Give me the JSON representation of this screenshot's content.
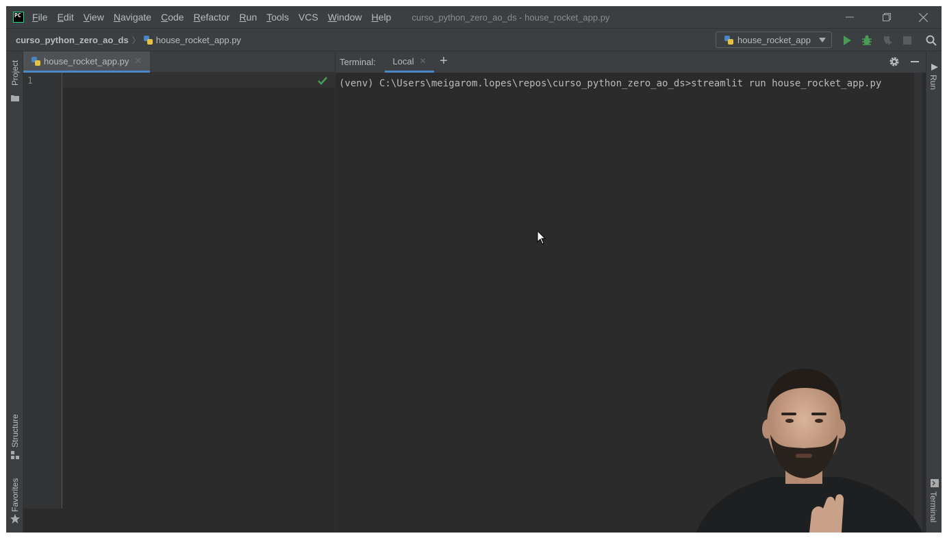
{
  "app": {
    "logo_text": "PC"
  },
  "menu": [
    {
      "label": "File",
      "mnemonic": "F",
      "rest": "ile"
    },
    {
      "label": "Edit",
      "mnemonic": "E",
      "rest": "dit"
    },
    {
      "label": "View",
      "mnemonic": "V",
      "rest": "iew"
    },
    {
      "label": "Navigate",
      "mnemonic": "N",
      "rest": "avigate"
    },
    {
      "label": "Code",
      "mnemonic": "C",
      "rest": "ode"
    },
    {
      "label": "Refactor",
      "mnemonic": "R",
      "rest": "efactor"
    },
    {
      "label": "Run",
      "mnemonic": "R",
      "rest": "un"
    },
    {
      "label": "Tools",
      "mnemonic": "T",
      "rest": "ools"
    },
    {
      "label": "VCS",
      "mnemonic": "",
      "rest": "VCS"
    },
    {
      "label": "Window",
      "mnemonic": "W",
      "rest": "indow"
    },
    {
      "label": "Help",
      "mnemonic": "H",
      "rest": "elp"
    }
  ],
  "window": {
    "title": "curso_python_zero_ao_ds - house_rocket_app.py"
  },
  "navbar": {
    "project": "curso_python_zero_ao_ds",
    "file": "house_rocket_app.py",
    "run_config": "house_rocket_app"
  },
  "tool_windows": {
    "project": "Project",
    "structure": "Structure",
    "favorites": "Favorites",
    "run": "Run",
    "terminal": "Terminal"
  },
  "editor": {
    "tab_label": "house_rocket_app.py",
    "line_numbers": [
      "1"
    ]
  },
  "terminal": {
    "title": "Terminal:",
    "tab_label": "Local",
    "command_line": "(venv) C:\\Users\\meigarom.lopes\\repos\\curso_python_zero_ao_ds>streamlit run house_rocket_app.py"
  },
  "colors": {
    "accent": "#4a88c7",
    "run_green": "#499c54",
    "background": "#2b2b2b",
    "chrome": "#3c3f41"
  }
}
